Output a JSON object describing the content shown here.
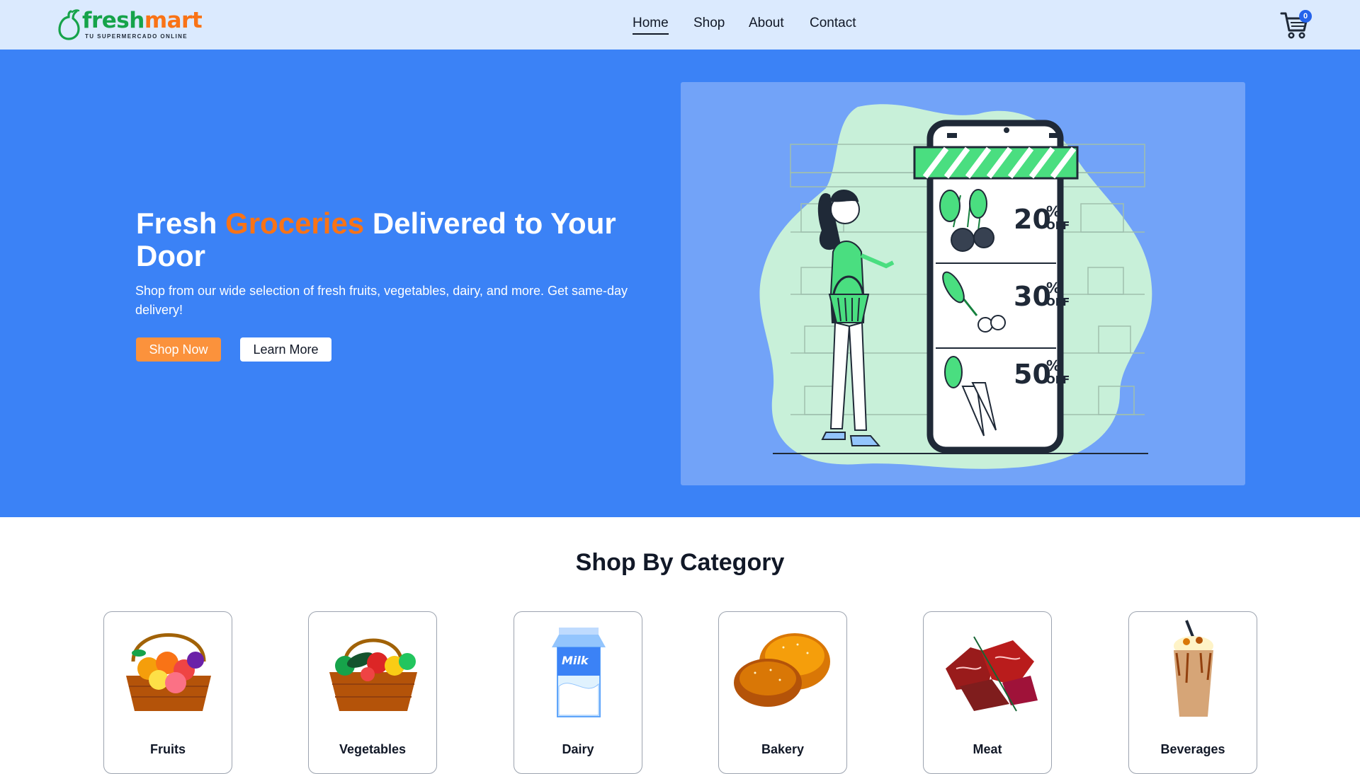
{
  "brand": {
    "name_part1": "fresh",
    "name_part2": "mart",
    "tagline": "TU SUPERMERCADO ONLINE",
    "colors": {
      "green": "#16a34a",
      "orange": "#f97316"
    }
  },
  "nav": {
    "links": [
      {
        "label": "Home",
        "active": true
      },
      {
        "label": "Shop",
        "active": false
      },
      {
        "label": "About",
        "active": false
      },
      {
        "label": "Contact",
        "active": false
      }
    ],
    "cart_icon": "shopping-cart-icon",
    "cart_count": "0"
  },
  "hero": {
    "title_before": "Fresh ",
    "title_accent": "Groceries",
    "title_after": " Delivered to Your Door",
    "subtitle": "Shop from our wide selection of fresh fruits, vegetables, dairy, and more. Get same-day delivery!",
    "primary_button": "Shop Now",
    "secondary_button": "Learn More",
    "background_color": "#3b82f6",
    "illustration": {
      "discounts": [
        {
          "number": "20",
          "percent": "%",
          "off": "OFF"
        },
        {
          "number": "30",
          "percent": "%",
          "off": "OFF"
        },
        {
          "number": "50",
          "percent": "%",
          "off": "OFF"
        }
      ]
    }
  },
  "categories": {
    "title": "Shop By Category",
    "items": [
      {
        "label": "Fruits",
        "icon": "fruit-basket-icon"
      },
      {
        "label": "Vegetables",
        "icon": "vegetable-basket-icon"
      },
      {
        "label": "Dairy",
        "icon": "milk-carton-icon",
        "image_text": "Milk"
      },
      {
        "label": "Bakery",
        "icon": "bread-buns-icon"
      },
      {
        "label": "Meat",
        "icon": "raw-meat-icon"
      },
      {
        "label": "Beverages",
        "icon": "milkshake-icon"
      }
    ]
  }
}
